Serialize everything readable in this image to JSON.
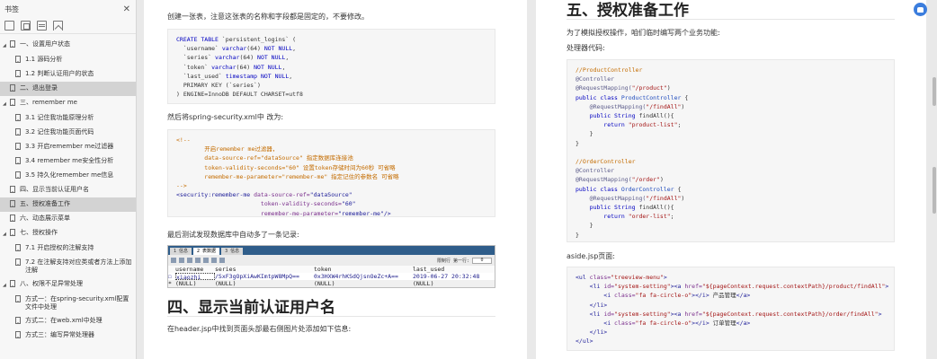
{
  "sidebar": {
    "title": "书签",
    "items": [
      {
        "label": "一、设置用户状态",
        "level": 1,
        "expanded": true
      },
      {
        "label": "1.1 源码分析",
        "level": 2
      },
      {
        "label": "1.2 判断认证用户的状态",
        "level": 2
      },
      {
        "label": "二、退出登录",
        "level": 1,
        "selected": true
      },
      {
        "label": "三、remember me",
        "level": 1,
        "expanded": true
      },
      {
        "label": "3.1 记住我功能原理分析",
        "level": 2
      },
      {
        "label": "3.2 记住我功能页面代码",
        "level": 2
      },
      {
        "label": "3.3 开启remember me过滤器",
        "level": 2
      },
      {
        "label": "3.4 remember me安全性分析",
        "level": 2
      },
      {
        "label": "3.5 持久化remember me信息",
        "level": 2
      },
      {
        "label": "四、显示当前认证用户名",
        "level": 1
      },
      {
        "label": "五、授权准备工作",
        "level": 1,
        "selected": true
      },
      {
        "label": "六、动态展示菜单",
        "level": 1
      },
      {
        "label": "七、授权操作",
        "level": 1,
        "expanded": true
      },
      {
        "label": "7.1 开启授权的注解支持",
        "level": 2
      },
      {
        "label": "7.2 在注解支持对应类或者方法上添加注解",
        "level": 2
      },
      {
        "label": "八、权限不足异常处理",
        "level": 1,
        "expanded": true
      },
      {
        "label": "方式一：在spring-security.xml配置文件中处理",
        "level": 2
      },
      {
        "label": "方式二：在web.xml中处理",
        "level": 2
      },
      {
        "label": "方式三：编写异常处理器",
        "level": 2
      }
    ]
  },
  "page1": {
    "intro": "创建一张表，注意这张表的名称和字段都是固定的，不要修改。",
    "sql": {
      "line1_kw": "CREATE TABLE",
      "line1_rest": " `persistent_logins` (",
      "line2": "  `username` ",
      "line2_type": "varchar",
      "line2_rest": "(64) ",
      "line2_kw": "NOT NULL",
      "line3": "  `series` ",
      "line3_type": "varchar",
      "line3_rest": "(64) ",
      "line3_kw": "NOT NULL",
      "line4": "  `token` ",
      "line4_type": "varchar",
      "line4_rest": "(64) ",
      "line4_kw": "NOT NULL",
      "line5": "  `last_used` ",
      "line5_type": "timestamp",
      "line5_rest": " ",
      "line5_kw": "NOT NULL",
      "line6": "  PRIMARY KEY (`series`)",
      "line7": ") ENGINE=InnoDB DEFAULT CHARSET=utf8"
    },
    "xml_caption": "然后将spring-security.xml中 改为:",
    "xml": {
      "c1": "<!--",
      "c2": "        开启remember me过滤器，",
      "c3": "        data-source-ref=\"dataSource\" 指定数据库连接池",
      "c4": "        token-validity-seconds=\"60\" 设置token存储时间为60秒 可省略",
      "c5": "        remember-me-parameter=\"remember-me\" 指定记住的参数名 可省略",
      "c6": "-->",
      "tag": "<security:remember-me",
      "a1": " data-source-ref=",
      "v1": "\"dataSource\"",
      "a2": "                        token-validity-seconds=",
      "v2": "\"60\"",
      "a3": "                        remember-me-parameter=",
      "v3": "\"remember-me\"",
      "end": "/>"
    },
    "db_caption": "最后测试发现数据库中自动多了一条记录:",
    "db": {
      "tab1": "1 信息",
      "tab2": "2 表数据",
      "tab3": "3 信息",
      "limit_label": "限制行 第一行:",
      "page": "0",
      "headers": [
        "username",
        "series",
        "token",
        "last_used"
      ],
      "row1": [
        "xiaozhi",
        "/SxF3gOpXiAwKImtpW8MpQ==",
        "0x3HXW4rhKSdQjsnOeZc+A==",
        "2019-06-27 20:32:48"
      ],
      "row2": [
        "(NULL)",
        "(NULL)",
        "(NULL)",
        "(NULL)"
      ]
    },
    "section4_title": "四、显示当前认证用户名",
    "section4_text": "在header.jsp中找到页面头部最右侧图片处添加如下信息:"
  },
  "page2": {
    "section5_title": "五、授权准备工作",
    "intro": "为了模拟授权操作，咱们临时编写两个业务功能:",
    "proc_label": "处理器代码:",
    "java": {
      "cm1": "//ProductController",
      "an1": "@Controller",
      "rm1a": "@RequestMapping(",
      "rm1b": "\"/product\"",
      "rm1c": ")",
      "cls1a": "public class",
      "cls1b": " ProductController",
      "cls1c": " {",
      "rm2a": "    @RequestMapping(",
      "rm2b": "\"/findAll\"",
      "rm2c": ")",
      "m1a": "    public",
      "m1b": " String",
      "m1c": " findAll(){",
      "r1a": "        return",
      "r1b": " \"product-list\"",
      "r1c": ";",
      "cb1": "    }",
      "cb2": "}",
      "cm2": "//OrderController",
      "an2": "@Controller",
      "rm3a": "@RequestMapping(",
      "rm3b": "\"/order\"",
      "rm3c": ")",
      "cls2a": "public class",
      "cls2b": " OrderController",
      "cls2c": " {",
      "rm4a": "    @RequestMapping(",
      "rm4b": "\"/findAll\"",
      "rm4c": ")",
      "m2a": "    public",
      "m2b": " String",
      "m2c": " findAll(){",
      "r2a": "        return",
      "r2b": " \"order-list\"",
      "r2c": ";",
      "cb3": "    }",
      "cb4": "}"
    },
    "aside_label": "aside.jsp页面:",
    "html": {
      "l1a": "<ul",
      "l1b": " class=",
      "l1c": "\"treeview-menu\"",
      "l1d": ">",
      "l2a": "    <li",
      "l2b": " id=",
      "l2c": "\"system-setting\"",
      "l2d": "><a",
      "l2e": " href=",
      "l2f": "\"${pageContext.request.contextPath}/product/findAll\"",
      "l2g": ">",
      "l3a": "        <i",
      "l3b": " class=",
      "l3c": "\"fa fa-circle-o\"",
      "l3d": "></i>",
      "l3e": " 产品管理",
      "l3f": "</a>",
      "l4": "    </li>",
      "l5a": "    <li",
      "l5b": " id=",
      "l5c": "\"system-setting\"",
      "l5d": "><a",
      "l5e": " href=",
      "l5f": "\"${pageContext.request.contextPath}/order/findAll\"",
      "l5g": ">",
      "l6a": "        <i",
      "l6b": " class=",
      "l6c": "\"fa fa-circle-o\"",
      "l6d": "></i>",
      "l6e": " 订单管理",
      "l6f": "</a>",
      "l7": "    </li>",
      "l8": "</ul>"
    }
  }
}
